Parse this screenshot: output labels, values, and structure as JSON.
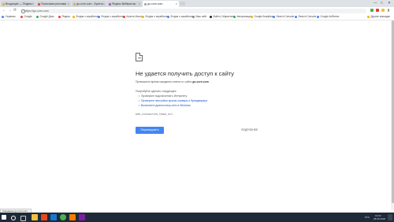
{
  "tabs": [
    {
      "label": "Входящие — Яндекс",
      "active": false,
      "color": "#e8a33d"
    },
    {
      "label": "Поисковая реклама",
      "active": false,
      "color": "#e34234"
    },
    {
      "label": "go-corn.com - Купить",
      "active": false,
      "color": "#e8a33d"
    },
    {
      "label": "Яндекс.Вебмастер",
      "active": false,
      "color": "#9b59b6"
    },
    {
      "label": "go-corn.com",
      "active": true,
      "color": "#9aa0a6"
    }
  ],
  "window": {
    "minimize": "—",
    "maximize": "□",
    "close": "✕"
  },
  "toolbar": {
    "back": "←",
    "forward": "→",
    "reload": "⟳",
    "url": "https://go-corn.com"
  },
  "bookmarks": [
    {
      "label": "Сервисы",
      "color": "#4285f4"
    },
    {
      "label": "Google",
      "color": "#ea4335"
    },
    {
      "label": "Google Диск",
      "color": "#34a853"
    },
    {
      "label": "Яндекс",
      "color": "#ff3333"
    },
    {
      "label": "Форум о заработке",
      "color": "#f4b400"
    },
    {
      "label": "Форум о заработке",
      "color": "#4285f4"
    },
    {
      "label": "Купить Масло",
      "color": "#ea4335"
    },
    {
      "label": "Форум о заработке",
      "color": "#f4b400"
    },
    {
      "label": "Форум о заработке",
      "color": "#4285f4"
    },
    {
      "label": "Ваш сайт",
      "color": "#888888"
    },
    {
      "label": "Войти | Маркетинг",
      "color": "#222222"
    },
    {
      "label": "Авторизация",
      "color": "#34a853"
    },
    {
      "label": "Google Analytics",
      "color": "#f4b400"
    },
    {
      "label": "Search Console",
      "color": "#4285f4"
    },
    {
      "label": "Search Console",
      "color": "#4285f4"
    },
    {
      "label": "Google AdSense",
      "color": "#4285f4"
    },
    {
      "label": "Другие закладки",
      "color": "#f4b400"
    }
  ],
  "error": {
    "title": "Не удается получить доступ к сайту",
    "subtitle_prefix": "Превышено время ожидания ответа от сайта",
    "subtitle_host": "go-corn.com",
    "try_label": "Попробуйте сделать следующее:",
    "suggestions": [
      {
        "text": "Проверьте подключение к Интернету",
        "link": false
      },
      {
        "text": "Проверьте настройки прокси-сервера и брандмауэра",
        "link": true
      },
      {
        "text": "Выполните диагностику сети в Windows",
        "link": true
      }
    ],
    "code": "ERR_CONNECTION_TIMED_OUT",
    "reload_label": "Перезагрузить",
    "details_label": "ПОДРОБНЕЕ"
  },
  "status_bar": {
    "text": "Ожидание go-corn.com..."
  },
  "taskbar": {
    "time": "19:33",
    "date": "28.06.2018",
    "lang": "РУС"
  }
}
